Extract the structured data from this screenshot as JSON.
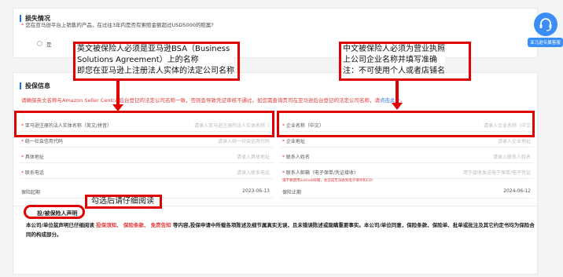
{
  "loss": {
    "title": "损失情况",
    "question": "您在亚马逊平台上销售的产品，在过往3年内是否有索赔金额超过USD5000的赔案?",
    "option_yes": "是"
  },
  "insured": {
    "title": "投保信息",
    "warning": "请确保英文名称与Amazon Seller Central后台登记的法定公司名称一致，否则会导致凭证审核不通过。如您需查询贵司在亚马逊后台登记的法定公司名称，请",
    "warning_link": "点击此处",
    "left_fields": [
      {
        "label": "亚马逊注册的法人实体名称（英文/拼音）",
        "value": "请录入亚马逊注册的法人实体名称（"
      },
      {
        "label": "统一社会信用代码",
        "value": "请录入统一社会信用代码"
      },
      {
        "label": "具体地址",
        "value": "请录入具体地址"
      },
      {
        "label": "联系电话",
        "value": "请录入联系电话"
      },
      {
        "label": "保险起期",
        "value": "2023-06-13"
      }
    ],
    "right_fields": [
      {
        "label": "企业名称（中文）",
        "value": "请录入企业名称（中文"
      },
      {
        "label": "企业地址",
        "value": "请录入企业地址"
      },
      {
        "label": "联系人姓名",
        "value": "请录入联系人姓名"
      },
      {
        "label": "联系人邮箱（电子保单/凭证接收）",
        "value": "用于接收发送电子保单/电子凭证",
        "hint": "请不要使用outlook邮箱，会造成无法收到电子保单和COI"
      },
      {
        "label": "保险止期",
        "value": "2024-06-12"
      }
    ]
  },
  "declaration": {
    "title": "投/被保险人声明",
    "text_before": "本公司/单位兹声明已仔细阅读",
    "link1": "投保须知",
    "sep1": "、",
    "link2": "保险条款",
    "sep2": "、",
    "link3": "免责告知",
    "text_after": "等内容,投保申请中所载各项陈述及细节属真实无误，且未错误陈述或隐瞒重要事实。本公司/单位同意，保险条款、保险单、批单或批注及其它约定书均为保险合同的构成部分。"
  },
  "annotations": {
    "left_lines": [
      "英文被保险人必须是亚马逊BSA（Business",
      "Solutions Agreement）上的名称",
      "即您在亚马逊上注册法人实体的法定公司名称"
    ],
    "right_lines": [
      "中文被保险人必须为营业执照",
      "上公司企业名称并填写准确",
      "注：不可使用个人或者店铺名"
    ],
    "check_note": "勾选后请仔细阅读"
  },
  "float_button": {
    "label": "亚马逊专属客服"
  },
  "colors": {
    "accent": "#1f73f1",
    "danger": "#e23b3b",
    "annotation": "#e00000"
  }
}
